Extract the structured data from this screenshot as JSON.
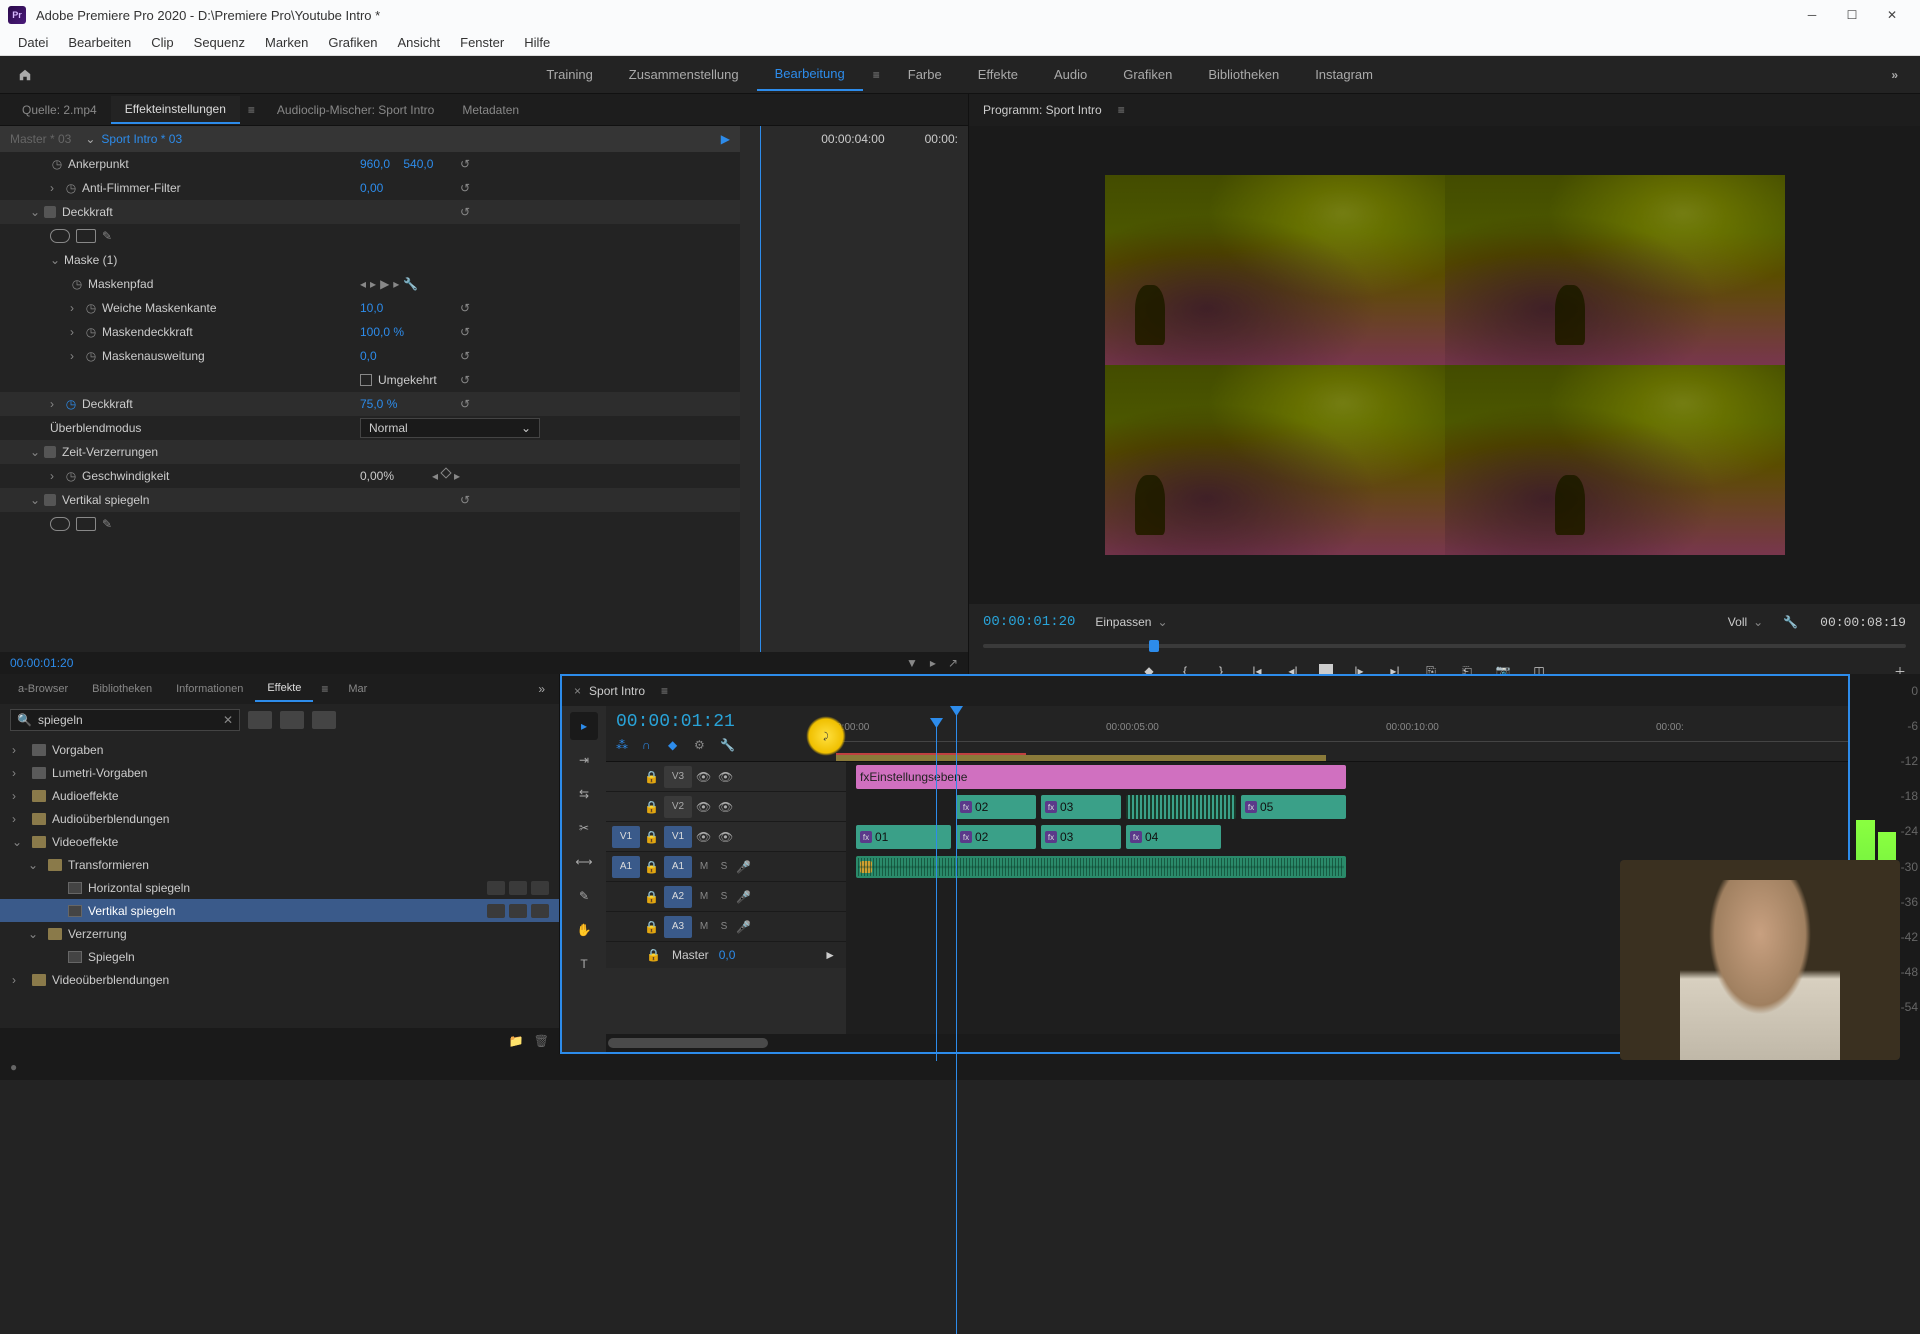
{
  "app": {
    "title": "Adobe Premiere Pro 2020 - D:\\Premiere Pro\\Youtube Intro *",
    "logo_text": "Pr"
  },
  "menu": [
    "Datei",
    "Bearbeiten",
    "Clip",
    "Sequenz",
    "Marken",
    "Grafiken",
    "Ansicht",
    "Fenster",
    "Hilfe"
  ],
  "workspaces": {
    "items": [
      "Training",
      "Zusammenstellung",
      "Bearbeitung",
      "Farbe",
      "Effekte",
      "Audio",
      "Grafiken",
      "Bibliotheken",
      "Instagram"
    ],
    "active": "Bearbeitung",
    "overflow": "»"
  },
  "source_tabs": {
    "items": [
      "Quelle: 2.mp4",
      "Effekteinstellungen",
      "Audioclip-Mischer: Sport Intro",
      "Metadaten"
    ],
    "active": "Effekteinstellungen"
  },
  "effect_controls": {
    "master": "Master * 03",
    "clip": "Sport Intro * 03",
    "timeline_tc1": "00:00:04:00",
    "timeline_tc2": "00:00:",
    "rows": {
      "ankerpunkt": {
        "label": "Ankerpunkt",
        "x": "960,0",
        "y": "540,0"
      },
      "antiflimmer": {
        "label": "Anti-Flimmer-Filter",
        "val": "0,00"
      },
      "deckkraft_section": "Deckkraft",
      "maske": "Maske (1)",
      "maskenpfad": "Maskenpfad",
      "weiche": {
        "label": "Weiche Maskenkante",
        "val": "10,0"
      },
      "maskendeck": {
        "label": "Maskendeckkraft",
        "val": "100,0 %"
      },
      "maskenausw": {
        "label": "Maskenausweitung",
        "val": "0,0"
      },
      "umgekehrt": "Umgekehrt",
      "deckkraft": {
        "label": "Deckkraft",
        "val": "75,0 %"
      },
      "blend": {
        "label": "Überblendmodus",
        "val": "Normal"
      },
      "zeit": "Zeit-Verzerrungen",
      "geschw": {
        "label": "Geschwindigkeit",
        "val": "0,00%"
      },
      "vspiegel": "Vertikal spiegeln"
    },
    "current_tc": "00:00:01:20"
  },
  "program": {
    "title": "Programm: Sport Intro",
    "timecode": "00:00:01:20",
    "fit": "Einpassen",
    "quality": "Voll",
    "duration": "00:00:08:19"
  },
  "effects_panel": {
    "tabs": [
      "a-Browser",
      "Bibliotheken",
      "Informationen",
      "Effekte",
      "Mar"
    ],
    "active": "Effekte",
    "overflow": "»",
    "search": "spiegeln",
    "tree": [
      {
        "label": "Vorgaben",
        "type": "preset",
        "lvl": 0
      },
      {
        "label": "Lumetri-Vorgaben",
        "type": "preset",
        "lvl": 0
      },
      {
        "label": "Audioeffekte",
        "type": "folder",
        "lvl": 0
      },
      {
        "label": "Audioüberblendungen",
        "type": "folder",
        "lvl": 0
      },
      {
        "label": "Videoeffekte",
        "type": "folder",
        "lvl": 0,
        "open": true
      },
      {
        "label": "Transformieren",
        "type": "folder",
        "lvl": 1,
        "open": true
      },
      {
        "label": "Horizontal spiegeln",
        "type": "effect",
        "lvl": 2,
        "badges": true
      },
      {
        "label": "Vertikal spiegeln",
        "type": "effect",
        "lvl": 2,
        "selected": true,
        "badges": true
      },
      {
        "label": "Verzerrung",
        "type": "folder",
        "lvl": 1,
        "open": true
      },
      {
        "label": "Spiegeln",
        "type": "effect",
        "lvl": 2
      },
      {
        "label": "Videoüberblendungen",
        "type": "folder",
        "lvl": 0
      }
    ]
  },
  "timeline": {
    "sequence": "Sport Intro",
    "timecode": "00:00:01:21",
    "ruler": [
      "0:00:00",
      "00:00:05:00",
      "00:00:10:00",
      "00:00:"
    ],
    "tracks": {
      "v3": "V3",
      "v2": "V2",
      "v1": "V1",
      "v1src": "V1",
      "a1": "A1",
      "a1src": "A1",
      "a2": "A2",
      "a3": "A3",
      "master": "Master",
      "master_val": "0,0"
    },
    "clips": {
      "adjustment": "Einstellungsebene",
      "v2": [
        "02",
        "03",
        "05"
      ],
      "v1": [
        "01",
        "02",
        "03",
        "04"
      ],
      "fx": "fx"
    },
    "mute": "M",
    "solo": "S"
  },
  "meters": {
    "scale": [
      "0",
      "-6",
      "-12",
      "-18",
      "-24",
      "-30",
      "-36",
      "-42",
      "-48",
      "-54"
    ]
  }
}
